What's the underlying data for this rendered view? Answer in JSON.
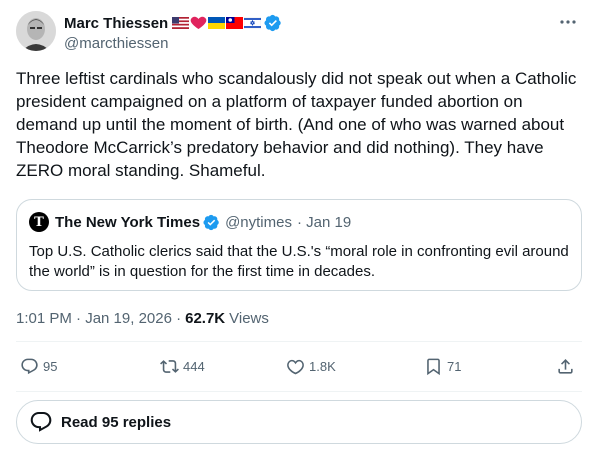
{
  "author": {
    "display_name": "Marc Thiessen",
    "handle": "@marcthiessen",
    "flag_emojis": [
      "us-flag-icon",
      "red-heart-icon",
      "ukraine-flag-icon",
      "taiwan-flag-icon",
      "israel-flag-icon"
    ]
  },
  "tweet": {
    "text": "Three leftist cardinals who scandalously did not speak out when a Catholic president campaigned on a platform of taxpayer funded abortion on demand up until the moment of birth. (And one of who was warned about Theodore McCarrick’s predatory behavior and did nothing). They have ZERO moral standing. Shameful."
  },
  "quote": {
    "name": "The New York Times",
    "handle": "@nytimes",
    "date": "· Jan 19",
    "text": "Top U.S. Catholic clerics said that the U.S.'s “moral role in confronting evil around the world” is in question for the first time in decades."
  },
  "meta": {
    "timestamp": "1:01 PM · Jan 19, 2026 ·",
    "views_count": "62.7K",
    "views_label": "Views"
  },
  "actions": {
    "replies": "95",
    "reposts": "444",
    "likes": "1.8K",
    "bookmarks": "71"
  },
  "read_replies_label": "Read 95 replies",
  "colors": {
    "accent": "#1d9bf0",
    "secondary_text": "#536471",
    "border": "#cfd9de"
  }
}
